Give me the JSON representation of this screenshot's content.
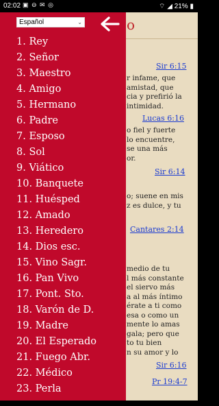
{
  "status": {
    "time": "02:02",
    "battery": "21%"
  },
  "language": "Español",
  "background": {
    "title_fragment": "o",
    "refs": [
      "Sir 6:15",
      "Lucas 6:16",
      "Sir 6:14",
      "Cantares 2:14",
      "Sir 6:16",
      "Pr 19:4-7"
    ],
    "paras": [
      [
        "r infame, que",
        "amistad, que",
        "cia y prefirió la",
        "intimidad."
      ],
      [
        "o fiel y fuerte",
        "lo encuentre,",
        "se una más",
        "or."
      ],
      [
        "o; suene en mis",
        "z es dulce, y tu"
      ],
      [
        "medio de tu",
        "l más constante",
        "el siervo más",
        "a al más íntimo",
        "érate a ti como",
        "esa o como un",
        "mente lo amas",
        "gala; pero que",
        "to tu bien",
        "n su amor y lo"
      ]
    ]
  },
  "menu": [
    "1. Rey",
    "2. Señor",
    "3. Maestro",
    "4. Amigo",
    "5. Hermano",
    "6. Padre",
    "7. Esposo",
    "8. Sol",
    "9. Viático",
    "10. Banquete",
    "11. Huésped",
    "12. Amado",
    "13. Heredero",
    "14. Dios esc.",
    "15. Vino Sagr.",
    "16. Pan Vivo",
    "17. Pont. Sto.",
    "18. Varón de D.",
    "19. Madre",
    "20. El Esperado",
    "21. Fuego Abr.",
    "22. Médico",
    "23. Perla"
  ]
}
